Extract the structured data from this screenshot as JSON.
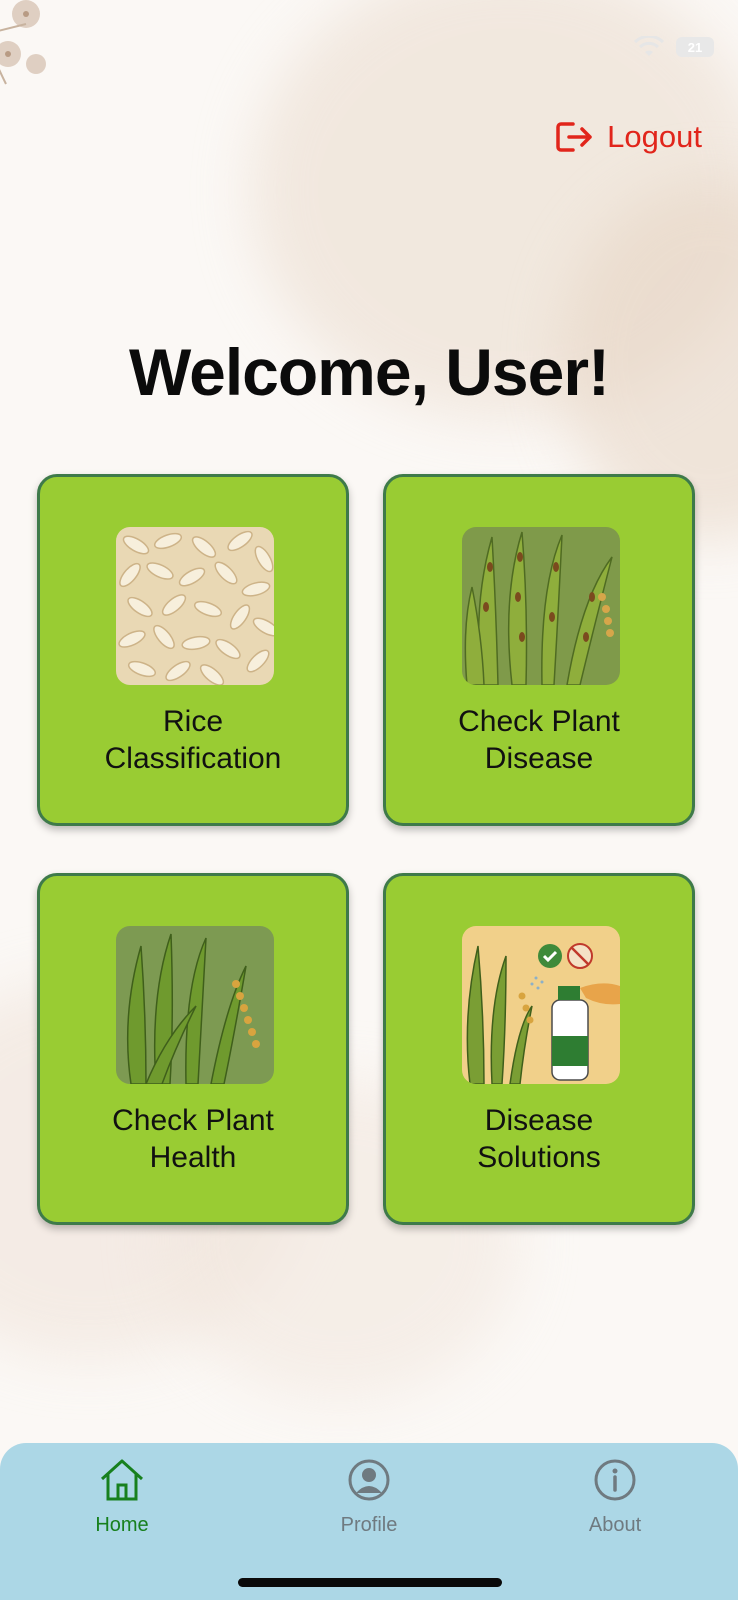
{
  "header": {
    "logout_label": "Logout",
    "battery_level": "21",
    "accent_color": "#e1251b"
  },
  "main": {
    "welcome": "Welcome, User!",
    "cards": [
      {
        "label": "Rice\nClassification",
        "icon": "rice-grains-image"
      },
      {
        "label": "Check Plant\nDisease",
        "icon": "diseased-rice-plant-image"
      },
      {
        "label": "Check Plant\nHealth",
        "icon": "healthy-rice-plant-image"
      },
      {
        "label": "Disease\nSolutions",
        "icon": "spray-treatment-image"
      }
    ],
    "card_color": "#99cc33"
  },
  "nav": {
    "items": [
      {
        "label": "Home",
        "icon": "home-icon",
        "active": true
      },
      {
        "label": "Profile",
        "icon": "profile-icon",
        "active": false
      },
      {
        "label": "About",
        "icon": "info-icon",
        "active": false
      }
    ],
    "active_color": "#17801e",
    "inactive_color": "#6f7a80",
    "background": "#acd7e6"
  }
}
